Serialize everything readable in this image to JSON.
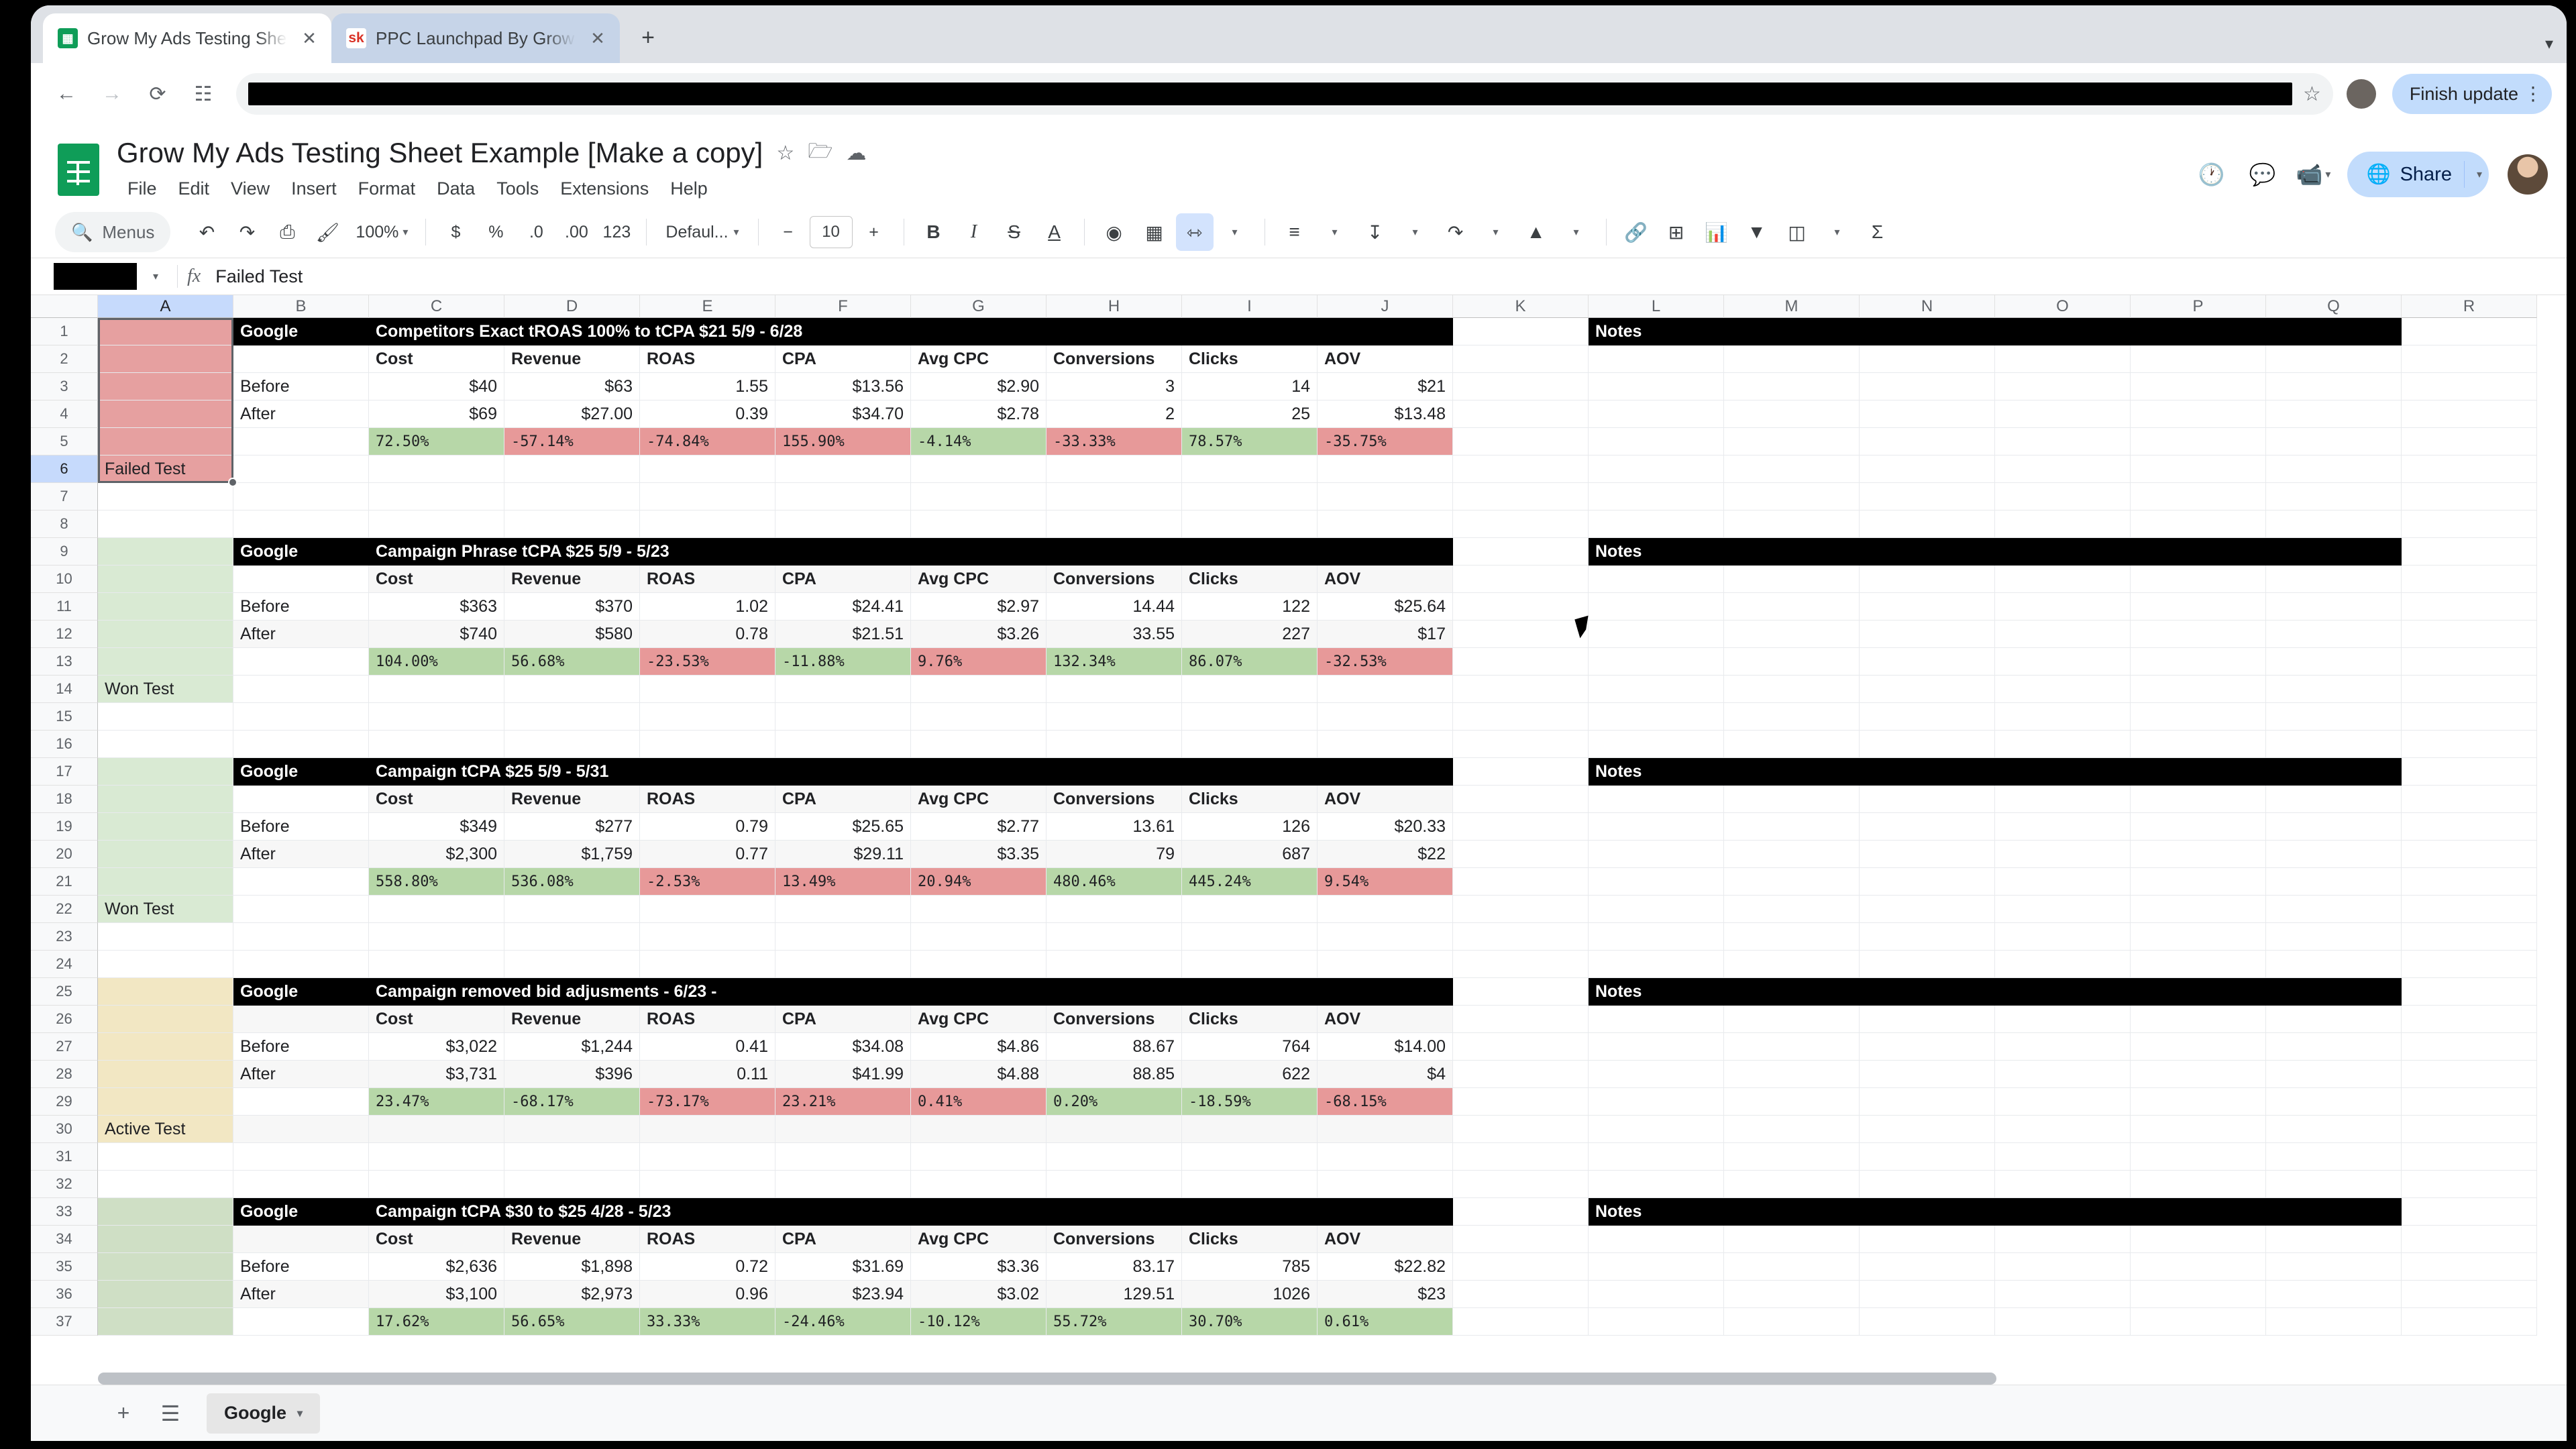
{
  "browser": {
    "tabs": [
      {
        "title": "Grow My Ads Testing Sheet E",
        "favicon": "sheets-icon",
        "active": true
      },
      {
        "title": "PPC Launchpad By GrowMyA",
        "favicon": "sk-icon",
        "active": false
      }
    ],
    "new_tab_label": "+",
    "back_label": "←",
    "forward_label": "→",
    "reload_label": "⟳",
    "split_label": "☷",
    "star_label": "☆",
    "finish_update_label": "Finish update",
    "kebab_label": "⋮"
  },
  "docs": {
    "title": "Grow My Ads Testing Sheet Example [Make a copy]",
    "title_icons": [
      "star-icon",
      "move-to-folder-icon",
      "cloud-saved-icon"
    ],
    "menus": [
      "File",
      "Edit",
      "View",
      "Insert",
      "Format",
      "Data",
      "Tools",
      "Extensions",
      "Help"
    ],
    "right_icons": [
      "version-history-icon",
      "comments-icon",
      "meet-icon"
    ],
    "share_label": "Share"
  },
  "toolbar": {
    "menus_label": "Menus",
    "search_icon": "search-icon",
    "undo": "↶",
    "redo": "↷",
    "print": "⎙",
    "paint": "paint-format-icon",
    "zoom_value": "100%",
    "currency": "$",
    "percent": "%",
    "decrease_decimal": ".0",
    "increase_decimal": ".00",
    "more_formats": "123",
    "font_name": "Defaul...",
    "font_decrease": "−",
    "font_size": "10",
    "font_increase": "+",
    "bold": "B",
    "italic": "I",
    "strikethrough": "S",
    "text_color": "A",
    "fill_color": "fill-color-icon",
    "borders": "borders-icon",
    "merge_cells": "merge-cells-icon",
    "horizontal_align": "align-icon",
    "vertical_align": "vertical-align-icon",
    "text_wrap": "text-wrap-icon",
    "text_rotation": "text-rotation-icon",
    "insert_link": "link-icon",
    "insert_comment": "insert-comment-icon",
    "insert_chart": "insert-chart-icon",
    "create_filter": "filter-icon",
    "functions": "Σ"
  },
  "formula_bar": {
    "name_box_value": "",
    "fx_label": "fx",
    "value": "Failed Test"
  },
  "grid": {
    "columns": [
      "A",
      "B",
      "C",
      "D",
      "E",
      "F",
      "G",
      "H",
      "I",
      "J",
      "K",
      "L",
      "M",
      "N",
      "O",
      "P",
      "Q",
      "R"
    ],
    "selected_column": "A",
    "selected_rows": [
      6
    ],
    "active_cell_value": "Failed Test",
    "row_numbers": [
      1,
      2,
      3,
      4,
      5,
      6,
      7,
      8,
      9,
      10,
      11,
      12,
      13,
      14,
      15,
      16,
      17,
      18,
      19,
      20,
      21,
      22,
      23,
      24,
      25,
      26,
      27,
      28,
      29,
      30,
      31,
      32,
      33,
      34,
      35,
      36,
      37
    ],
    "metric_headers": [
      "Cost",
      "Revenue",
      "ROAS",
      "CPA",
      "Avg CPC",
      "Conversions",
      "Clicks",
      "AOV"
    ],
    "notes_label": "Notes",
    "platform_label": "Google",
    "before_label": "Before",
    "after_label": "After",
    "blocks": [
      {
        "title_row": 1,
        "status_row": 6,
        "status": "Failed Test",
        "status_color": "#e6a0a0",
        "platform": "Google",
        "title": "Competitors Exact tROAS 100% to tCPA $21 5/9 - 6/28",
        "before": [
          "$40",
          "$63",
          "1.55",
          "$13.56",
          "$2.90",
          "3",
          "14",
          "$21"
        ],
        "after": [
          "$69",
          "$27.00",
          "0.39",
          "$34.70",
          "$2.78",
          "2",
          "25",
          "$13.48"
        ],
        "delta": [
          "72.50%",
          "-57.14%",
          "-74.84%",
          "155.90%",
          "-4.14%",
          "-33.33%",
          "78.57%",
          "-35.75%"
        ],
        "delta_colors": [
          "green",
          "red",
          "red",
          "red",
          "green",
          "red",
          "green",
          "red"
        ]
      },
      {
        "title_row": 9,
        "status_row": 14,
        "status": "Won Test",
        "status_color": "#d9ead3",
        "platform": "Google",
        "title": "Campaign Phrase tCPA $25 5/9 - 5/23",
        "before": [
          "$363",
          "$370",
          "1.02",
          "$24.41",
          "$2.97",
          "14.44",
          "122",
          "$25.64"
        ],
        "after": [
          "$740",
          "$580",
          "0.78",
          "$21.51",
          "$3.26",
          "33.55",
          "227",
          "$17"
        ],
        "delta": [
          "104.00%",
          "56.68%",
          "-23.53%",
          "-11.88%",
          "9.76%",
          "132.34%",
          "86.07%",
          "-32.53%"
        ],
        "delta_colors": [
          "green",
          "green",
          "red",
          "green",
          "red",
          "green",
          "green",
          "red"
        ]
      },
      {
        "title_row": 17,
        "status_row": 22,
        "status": "Won Test",
        "status_color": "#d9ead3",
        "platform": "Google",
        "title": "Campaign tCPA $25 5/9 - 5/31",
        "before": [
          "$349",
          "$277",
          "0.79",
          "$25.65",
          "$2.77",
          "13.61",
          "126",
          "$20.33"
        ],
        "after": [
          "$2,300",
          "$1,759",
          "0.77",
          "$29.11",
          "$3.35",
          "79",
          "687",
          "$22"
        ],
        "delta": [
          "558.80%",
          "536.08%",
          "-2.53%",
          "13.49%",
          "20.94%",
          "480.46%",
          "445.24%",
          "9.54%"
        ],
        "delta_colors": [
          "green",
          "green",
          "red",
          "red",
          "red",
          "green",
          "green",
          "red"
        ]
      },
      {
        "title_row": 25,
        "status_row": 30,
        "status": "Active Test",
        "status_color": "#f2e7c3",
        "platform": "Google",
        "title": "Campaign  removed bid adjusments - 6/23 -",
        "before": [
          "$3,022",
          "$1,244",
          "0.41",
          "$34.08",
          "$4.86",
          "88.67",
          "764",
          "$14.00"
        ],
        "after": [
          "$3,731",
          "$396",
          "0.11",
          "$41.99",
          "$4.88",
          "88.85",
          "622",
          "$4"
        ],
        "delta": [
          "23.47%",
          "-68.17%",
          "-73.17%",
          "23.21%",
          "0.41%",
          "0.20%",
          "-18.59%",
          "-68.15%"
        ],
        "delta_colors": [
          "green",
          "green",
          "red",
          "red",
          "red",
          "green",
          "green",
          "red"
        ]
      },
      {
        "title_row": 33,
        "status_row": 38,
        "status": "",
        "status_color": "#cfdfc5",
        "platform": "Google",
        "title": "Campaign  tCPA $30 to $25 4/28 - 5/23",
        "before": [
          "$2,636",
          "$1,898",
          "0.72",
          "$31.69",
          "$3.36",
          "83.17",
          "785",
          "$22.82"
        ],
        "after": [
          "$3,100",
          "$2,973",
          "0.96",
          "$23.94",
          "$3.02",
          "129.51",
          "1026",
          "$23"
        ],
        "delta": [
          "17.62%",
          "56.65%",
          "33.33%",
          "-24.46%",
          "-10.12%",
          "55.72%",
          "30.70%",
          "0.61%"
        ],
        "delta_colors": [
          "green",
          "green",
          "green",
          "green",
          "green",
          "green",
          "green",
          "green"
        ]
      }
    ]
  },
  "sheet_bar": {
    "add_sheet": "+",
    "all_sheets": "☰",
    "tabs": [
      {
        "name": "Google",
        "active": true
      }
    ],
    "tab_caret": "▾"
  },
  "colors": {
    "green_fill": "#b7d7a8",
    "red_fill": "#e79999",
    "header_black": "#000000",
    "accent_blue": "#c2dcfc"
  }
}
